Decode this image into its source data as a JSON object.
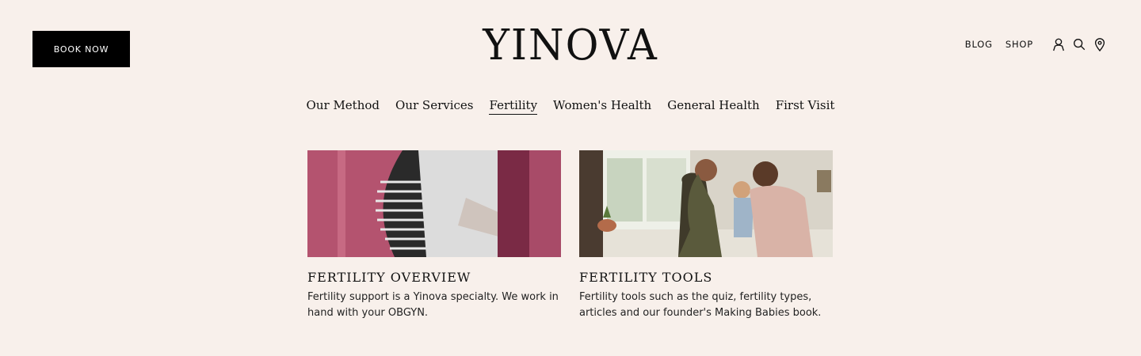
{
  "header": {
    "book_label": "BOOK NOW",
    "logo": "YINOVA",
    "links": [
      "BLOG",
      "SHOP"
    ],
    "icons": [
      "user-icon",
      "search-icon",
      "location-pin-icon"
    ]
  },
  "nav": {
    "items": [
      "Our Method",
      "Our Services",
      "Fertility",
      "Women's Health",
      "General Health",
      "First Visit"
    ],
    "active": "Fertility"
  },
  "cards": [
    {
      "title": "FERTILITY OVERVIEW",
      "description": "Fertility support is a Yinova specialty. We work in hand with your OBGYN."
    },
    {
      "title": "FERTILITY TOOLS",
      "description": "Fertility tools such as the quiz, fertility types, articles and our founder's Making Babies book."
    }
  ],
  "colors": {
    "background": "#f8f0eb",
    "button": "#000000",
    "text": "#111111"
  }
}
